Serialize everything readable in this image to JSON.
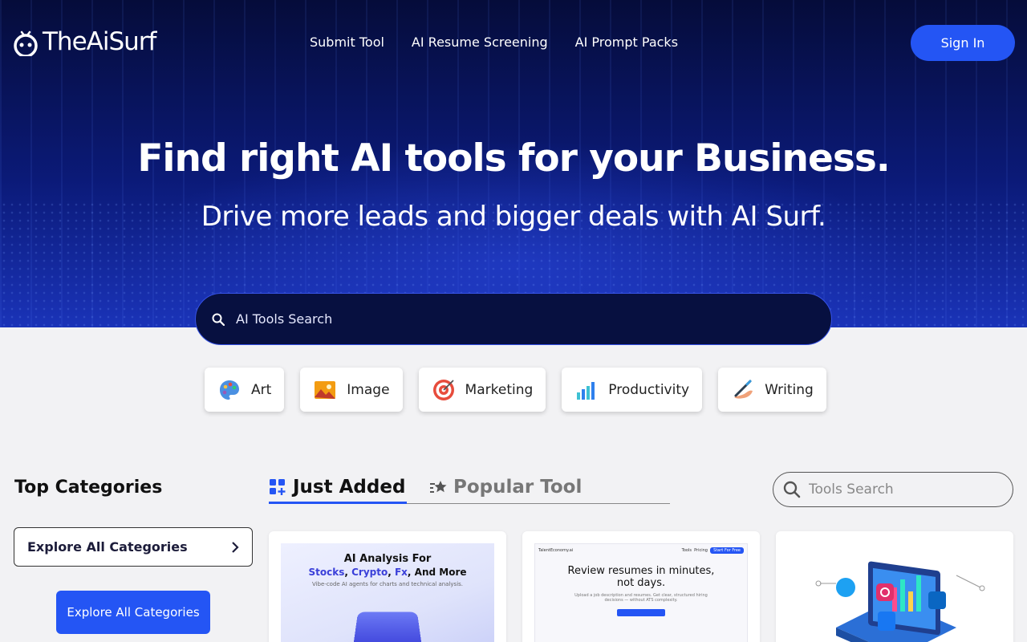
{
  "brand": {
    "name": "TheAiSurf"
  },
  "nav": {
    "items": [
      "Submit Tool",
      "AI Resume Screening",
      "AI Prompt Packs"
    ],
    "sign_in": "Sign In"
  },
  "hero": {
    "title": "Find right AI tools for your Business.",
    "subtitle": "Drive more leads and bigger deals with AI Surf.",
    "search_placeholder": "AI Tools Search"
  },
  "chips": [
    {
      "label": "Art",
      "icon": "palette-icon"
    },
    {
      "label": "Image",
      "icon": "picture-icon"
    },
    {
      "label": "Marketing",
      "icon": "target-icon"
    },
    {
      "label": "Productivity",
      "icon": "bar-chart-icon"
    },
    {
      "label": "Writing",
      "icon": "pen-hand-icon"
    }
  ],
  "sidebar": {
    "title": "Top Categories",
    "explore_outline": "Explore All Categories",
    "explore_button": "Explore All Categories"
  },
  "tabs": {
    "active": "Just Added",
    "inactive": "Popular Tool"
  },
  "tools_search": {
    "placeholder": "Tools Search"
  },
  "cards": [
    {
      "thumb_line1": "AI Analysis For",
      "thumb_line2_parts": [
        "Stocks",
        "Crypto",
        "Fx",
        "And More"
      ],
      "thumb_line3": "Vibe-code AI agents for charts and technical analysis."
    },
    {
      "brand": "TalentEconomy.ai",
      "nav1": "Tools",
      "nav2": "Pricing",
      "pill": "Start For Free",
      "headline1": "Review resumes in minutes,",
      "headline2": "not days.",
      "para": "Upload a job description and resumes. Get clear, structured hiring decisions — without ATS complexity."
    },
    {
      "alt": "social-media-network-illustration"
    }
  ],
  "colors": {
    "accent": "#2455f4",
    "hero_dark": "#050c3a",
    "hero_mid": "#1a33b8",
    "page_bg": "#f2f2f4"
  }
}
